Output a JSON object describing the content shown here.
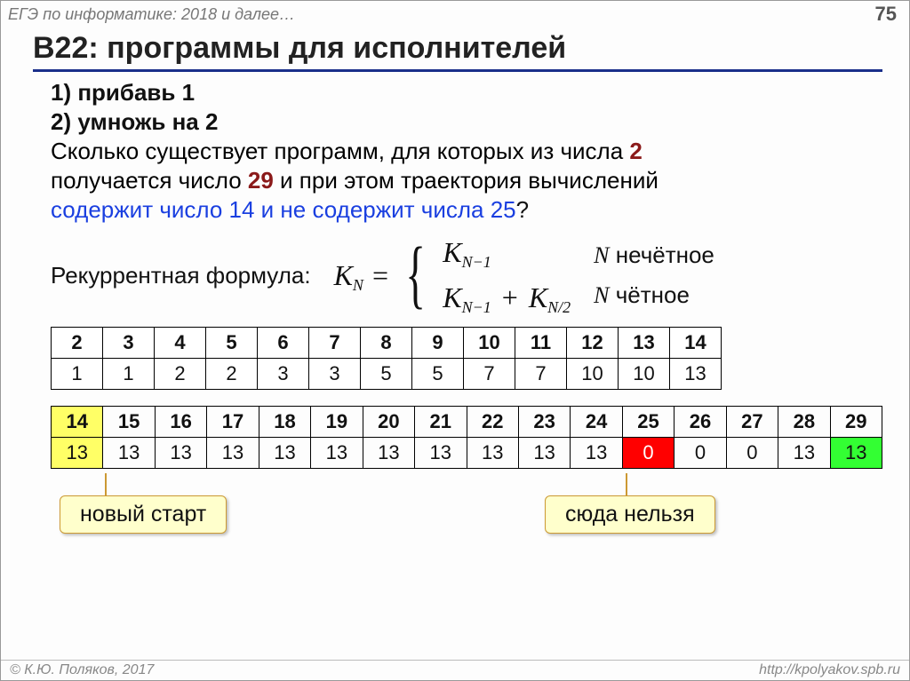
{
  "header": {
    "breadcrumb": "ЕГЭ по информатике: 2018 и далее…",
    "page": "75"
  },
  "title": "B22: программы для исполнителей",
  "ops": {
    "one": "1)  прибавь 1",
    "two": "2)  умножь на 2"
  },
  "question": {
    "l1a": "Сколько существует программ, для которых из числа ",
    "n1": "2",
    "l2a": "получается число ",
    "n2": "29",
    "l2b": " и при этом траектория вычислений ",
    "l3": "содержит число 14 и не содержит числа 25",
    "qmark": "?"
  },
  "formula": {
    "label": "Рекуррентная формула:",
    "lhs": "K",
    "lhs_sub": "N",
    "eq": "=",
    "case1": "K",
    "case1_sub": "N−1",
    "case2a": "K",
    "case2a_sub": "N−1",
    "plus": "+",
    "case2b": "K",
    "case2b_sub": "N/2",
    "cond1a": "N",
    "cond1b": " нечётное",
    "cond2a": "N",
    "cond2b": " чётное"
  },
  "chart_data": [
    {
      "type": "table",
      "title": "Trajectory counts 2..14",
      "headers": [
        "2",
        "3",
        "4",
        "5",
        "6",
        "7",
        "8",
        "9",
        "10",
        "11",
        "12",
        "13",
        "14"
      ],
      "values": [
        "1",
        "1",
        "2",
        "2",
        "3",
        "3",
        "5",
        "5",
        "7",
        "7",
        "10",
        "10",
        "13"
      ]
    },
    {
      "type": "table",
      "title": "Trajectory counts 14..29 with forbidden 25",
      "headers": [
        "14",
        "15",
        "16",
        "17",
        "18",
        "19",
        "20",
        "21",
        "22",
        "23",
        "24",
        "25",
        "26",
        "27",
        "28",
        "29"
      ],
      "values": [
        "13",
        "13",
        "13",
        "13",
        "13",
        "13",
        "13",
        "13",
        "13",
        "13",
        "13",
        "0",
        "0",
        "0",
        "13",
        "13"
      ],
      "highlights": {
        "start_col": 0,
        "forbidden_col": 11,
        "answer_col": 15
      }
    }
  ],
  "callouts": {
    "left": "новый старт",
    "right": "сюда нельзя"
  },
  "footer": {
    "copyright": "© К.Ю. Поляков, 2017",
    "url": "http://kpolyakov.spb.ru"
  }
}
